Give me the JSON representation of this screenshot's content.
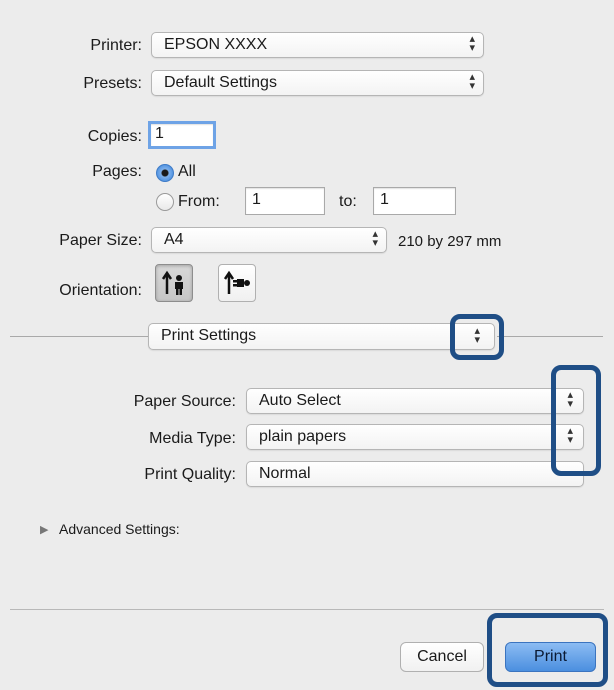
{
  "printer": {
    "label": "Printer:",
    "value": "EPSON XXXX"
  },
  "presets": {
    "label": "Presets:",
    "value": "Default Settings"
  },
  "copies": {
    "label": "Copies:",
    "value": "1"
  },
  "pages": {
    "label": "Pages:",
    "all_label": "All",
    "from_label": "From:",
    "from_value": "1",
    "to_label": "to:",
    "to_value": "1",
    "selected": "All"
  },
  "paper_size": {
    "label": "Paper Size:",
    "value": "A4",
    "dimensions": "210 by 297 mm"
  },
  "orientation": {
    "label": "Orientation:",
    "selected": "portrait",
    "options": [
      "portrait",
      "landscape"
    ]
  },
  "section_menu": {
    "value": "Print Settings"
  },
  "paper_source": {
    "label": "Paper Source:",
    "value": "Auto Select"
  },
  "media_type": {
    "label": "Media Type:",
    "value": "plain papers"
  },
  "print_quality": {
    "label": "Print Quality:",
    "value": "Normal"
  },
  "advanced": {
    "label": "Advanced Settings:"
  },
  "buttons": {
    "cancel": "Cancel",
    "print": "Print"
  },
  "colors": {
    "highlight": "#1f4e86",
    "default_button": "#4b8fdf"
  }
}
